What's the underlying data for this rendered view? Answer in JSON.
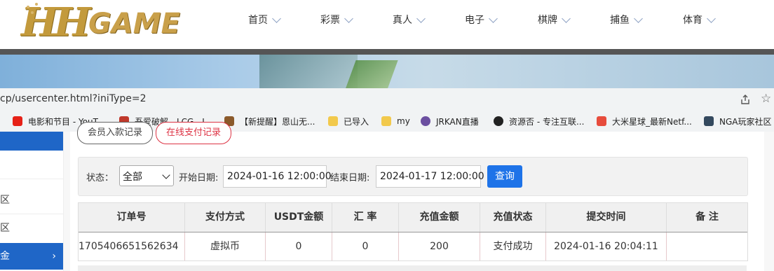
{
  "site": {
    "logo_text_1": "HH",
    "logo_text_2": "GAME",
    "nav": [
      "首页",
      "彩票",
      "真人",
      "电子",
      "棋牌",
      "捕鱼",
      "体育"
    ]
  },
  "browser": {
    "address": "cp/usercenter.html?iniType=2",
    "bookmarks": [
      {
        "label": "电影和节目 - YouT...",
        "icon": "youtube-icon",
        "color": "#e62117"
      },
      {
        "label": "吾爱破解 - LCG - L...",
        "icon": "52pojie-icon",
        "color": "#c0392b"
      },
      {
        "label": "【新提醒】恩山无...",
        "icon": "right-icon",
        "color": "#8b5a2b"
      },
      {
        "label": "已导入",
        "icon": "folder-icon",
        "color": "#f2c94c"
      },
      {
        "label": "my",
        "icon": "folder-icon",
        "color": "#f2c94c"
      },
      {
        "label": "JRKAN直播",
        "icon": "jrkan-icon",
        "color": "#6b4fa0"
      },
      {
        "label": "资源否 - 专注互联...",
        "icon": "ziyuan-icon",
        "color": "#222222"
      },
      {
        "label": "大米星球_最新Netf...",
        "icon": "dami-icon",
        "color": "#e74c3c"
      },
      {
        "label": "NGA玩家社区",
        "icon": "nga-icon",
        "color": "#34495e"
      }
    ]
  },
  "sidebar": {
    "items": [
      {
        "label": "区",
        "active": false
      },
      {
        "label": "区",
        "active": false
      },
      {
        "label": "金",
        "active": true
      }
    ]
  },
  "tabs": {
    "left": "会员入款记录",
    "right": "在线支付记录"
  },
  "filter": {
    "status_label": "状态：",
    "status_value": "全部",
    "start_label": "开始日期:",
    "start_value": "2024-01-16 12:00:00",
    "end_label": "结束日期:",
    "end_value": "2024-01-17 12:00:00",
    "query_button": "查询"
  },
  "table": {
    "headers": [
      "订单号",
      "支付方式",
      "USDT金额",
      "汇 率",
      "充值金额",
      "充值状态",
      "提交时间",
      "备 注"
    ],
    "rows": [
      [
        "1705406651562634",
        "虚拟币",
        "0",
        "0",
        "200",
        "支付成功",
        "2024-01-16 20:04:11",
        ""
      ]
    ]
  },
  "colors": {
    "accent_blue": "#1e73e8",
    "logo_gold": "#c39a3c",
    "red_pill": "#dd3344"
  }
}
